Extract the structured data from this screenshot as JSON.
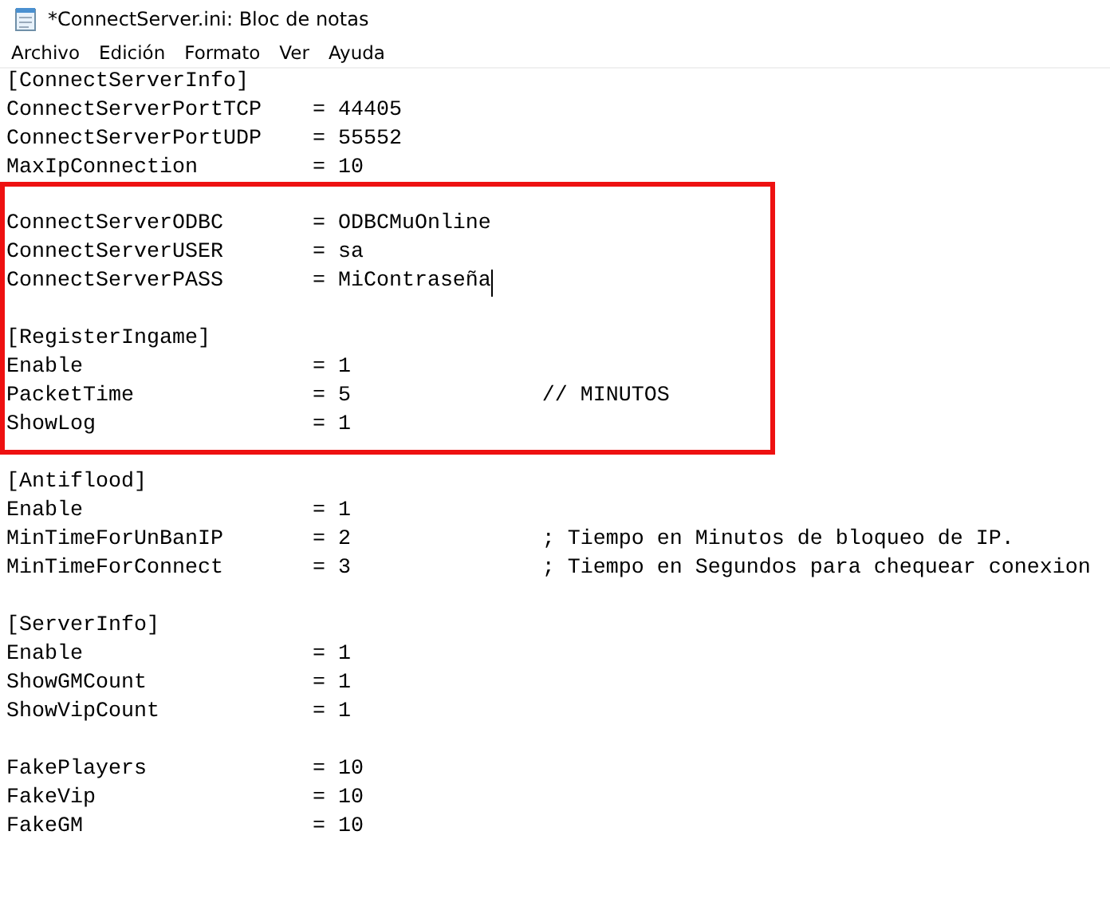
{
  "window": {
    "title": "*ConnectServer.ini: Bloc de notas"
  },
  "menu": [
    {
      "label": "Archivo"
    },
    {
      "label": "Edición"
    },
    {
      "label": "Formato"
    },
    {
      "label": "Ver"
    },
    {
      "label": "Ayuda"
    }
  ],
  "editor": {
    "groups": [
      {
        "highlighted": false,
        "lines": [
          {
            "text": "[ConnectServerInfo]",
            "cursor": false
          },
          {
            "text": "ConnectServerPortTCP    = 44405",
            "cursor": false
          },
          {
            "text": "ConnectServerPortUDP    = 55552",
            "cursor": false
          },
          {
            "text": "MaxIpConnection         = 10",
            "cursor": false
          }
        ]
      },
      {
        "highlighted": true,
        "lines": [
          {
            "text": "ConnectServerODBC       = ODBCMuOnline",
            "cursor": false
          },
          {
            "text": "ConnectServerUSER       = sa",
            "cursor": false
          },
          {
            "text": "ConnectServerPASS       = MiContraseña",
            "cursor": true
          }
        ]
      },
      {
        "highlighted": true,
        "lines": [
          {
            "text": "[RegisterIngame]",
            "cursor": false
          },
          {
            "text": "Enable                  = 1",
            "cursor": false
          },
          {
            "text": "PacketTime              = 5               // MINUTOS",
            "cursor": false
          },
          {
            "text": "ShowLog                 = 1",
            "cursor": false
          }
        ]
      },
      {
        "highlighted": false,
        "lines": [
          {
            "text": "[Antiflood]",
            "cursor": false
          },
          {
            "text": "Enable                  = 1",
            "cursor": false
          },
          {
            "text": "MinTimeForUnBanIP       = 2               ; Tiempo en Minutos de bloqueo de IP.",
            "cursor": false
          },
          {
            "text": "MinTimeForConnect       = 3               ; Tiempo en Segundos para chequear conexion",
            "cursor": false
          }
        ]
      },
      {
        "highlighted": false,
        "lines": [
          {
            "text": "[ServerInfo]",
            "cursor": false
          },
          {
            "text": "Enable                  = 1",
            "cursor": false
          },
          {
            "text": "ShowGMCount             = 1",
            "cursor": false
          },
          {
            "text": "ShowVipCount            = 1",
            "cursor": false
          }
        ]
      },
      {
        "highlighted": false,
        "lines": [
          {
            "text": "FakePlayers             = 10",
            "cursor": false
          },
          {
            "text": "FakeVip                 = 10",
            "cursor": false
          },
          {
            "text": "FakeGM                  = 10",
            "cursor": false
          }
        ]
      }
    ]
  }
}
